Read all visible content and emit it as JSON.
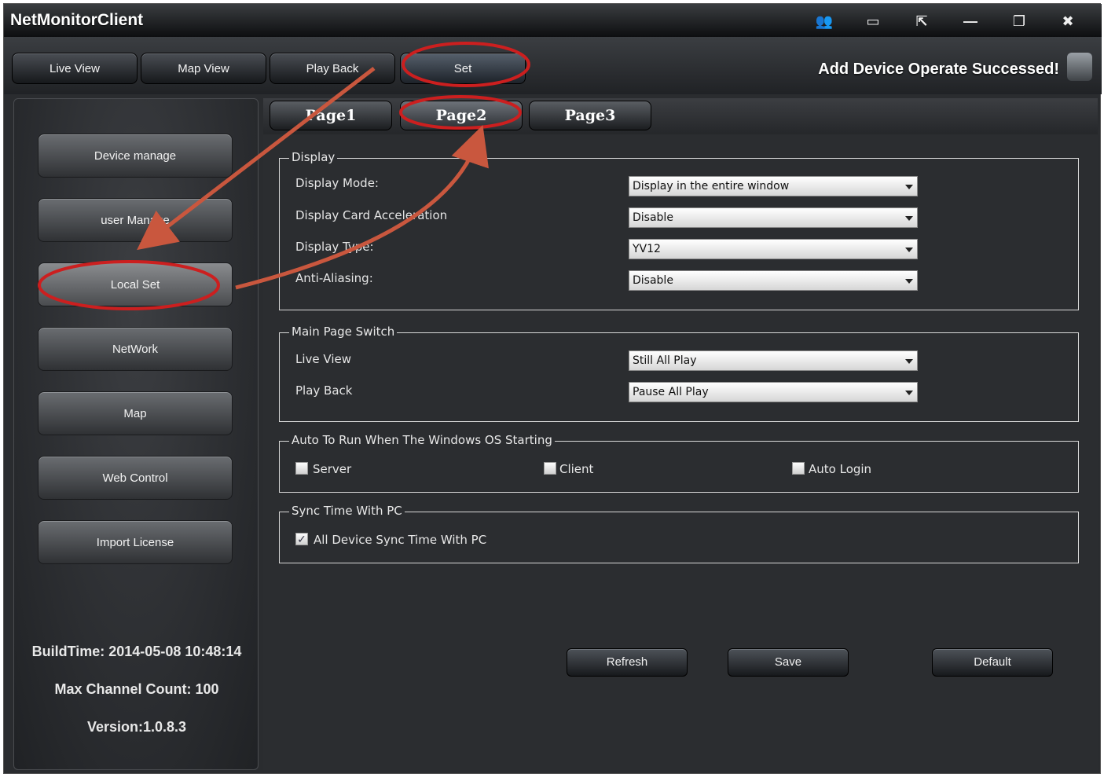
{
  "window": {
    "title": "NetMonitorClient",
    "controls": [
      {
        "name": "users-icon",
        "glyph": "👥"
      },
      {
        "name": "window-layout-icon",
        "glyph": "▭"
      },
      {
        "name": "fullscreen-icon",
        "glyph": "⇱"
      },
      {
        "name": "minimize-icon",
        "glyph": "—"
      },
      {
        "name": "restore-icon",
        "glyph": "❐"
      },
      {
        "name": "close-icon",
        "glyph": "✖"
      }
    ]
  },
  "topnav": {
    "tabs": [
      "Live View",
      "Map View",
      "Play Back",
      "Set"
    ],
    "active": "Set",
    "status_message": "Add Device Operate Successed!"
  },
  "sidebar": {
    "items": [
      "Device manage",
      "user Manage",
      "Local Set",
      "NetWork",
      "Map",
      "Web Control",
      "Import License"
    ],
    "active": "Local Set",
    "build_time": "BuildTime: 2014-05-08 10:48:14",
    "max_channel": "Max Channel Count: 100",
    "version": "Version:1.0.8.3"
  },
  "pages": {
    "tabs": [
      "Page1",
      "Page2",
      "Page3"
    ],
    "active": "Page2"
  },
  "display": {
    "legend": "Display",
    "rows": [
      {
        "label": "Display Mode:",
        "value": "Display in the entire window"
      },
      {
        "label": "Display Card Acceleration",
        "value": "Disable"
      },
      {
        "label": "Display Type:",
        "value": "YV12"
      },
      {
        "label": "Anti-Aliasing:",
        "value": "Disable"
      }
    ]
  },
  "main_page_switch": {
    "legend": "Main Page Switch",
    "rows": [
      {
        "label": "Live View",
        "value": "Still All Play"
      },
      {
        "label": "Play Back",
        "value": "Pause All Play"
      }
    ]
  },
  "autorun": {
    "legend": "Auto To Run When The Windows OS Starting",
    "options": [
      {
        "label": "Server",
        "checked": false
      },
      {
        "label": "Client",
        "checked": false
      },
      {
        "label": "Auto Login",
        "checked": false
      }
    ]
  },
  "sync": {
    "legend": "Sync Time With PC",
    "option": {
      "label": "All Device Sync Time With PC",
      "checked": true
    }
  },
  "actions": {
    "refresh": "Refresh",
    "save": "Save",
    "default": "Default"
  },
  "colors": {
    "annotation": "#cc1f1f",
    "arrow": "#c9573e"
  }
}
